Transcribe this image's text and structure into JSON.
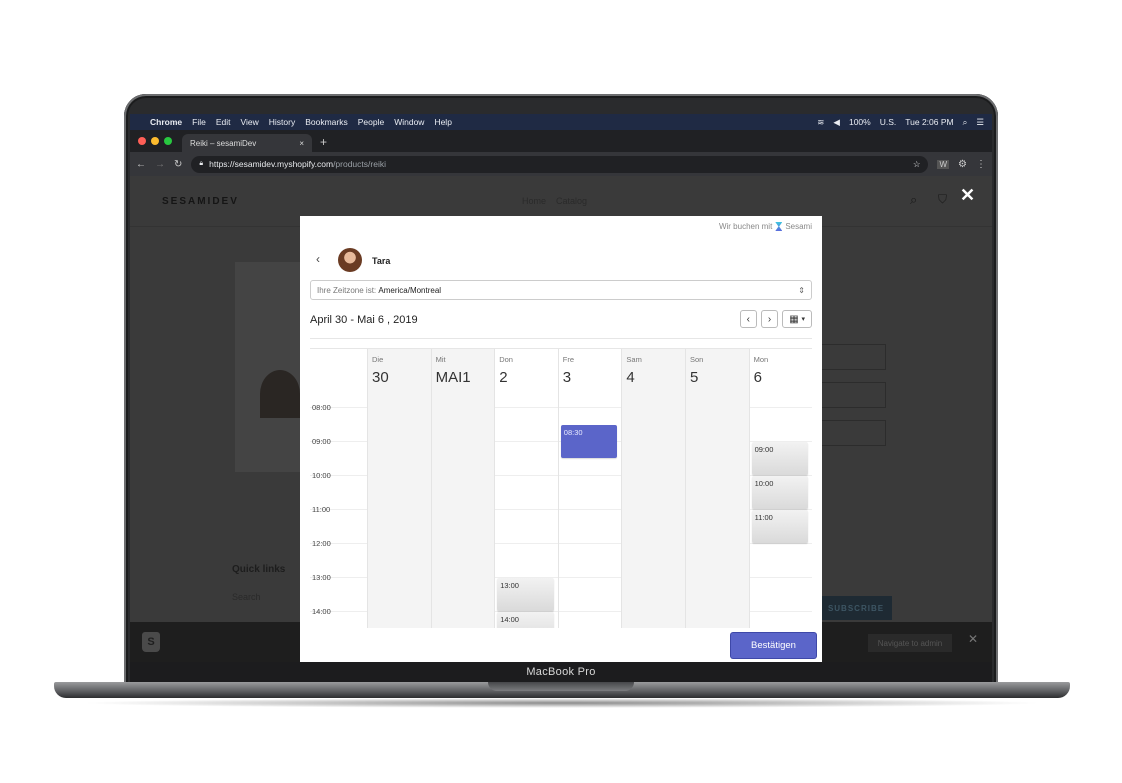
{
  "device": {
    "label": "MacBook Pro"
  },
  "menubar": {
    "items": [
      "Chrome",
      "File",
      "Edit",
      "View",
      "History",
      "Bookmarks",
      "People",
      "Window",
      "Help"
    ],
    "battery": "100%",
    "input": "U.S.",
    "clock": "Tue 2:06 PM"
  },
  "browser": {
    "tab_title": "Reiki – sesamiDev",
    "url_host": "https://sesamidev.myshopify.com",
    "url_path": "/products/reiki"
  },
  "shop": {
    "logo": "SESAMIDEV",
    "nav": [
      "Home",
      "Catalog"
    ],
    "quick_links": "Quick links",
    "search": "Search",
    "subscribe": "SUBSCRIBE",
    "navigate_admin": "Navigate to admin"
  },
  "widget": {
    "booked_with": "Wir buchen mit",
    "brand": "Sesami",
    "provider": "Tara",
    "tz_label": "Ihre Zeitzone ist:",
    "tz_value": "America/Montreal",
    "range": "April 30 - Mai  6 , 2019",
    "confirm": "Bestätigen",
    "days": [
      {
        "name": "Die",
        "num": "30",
        "past": true
      },
      {
        "name": "Mit",
        "num": "MAI1",
        "past": true
      },
      {
        "name": "Don",
        "num": "2",
        "past": false
      },
      {
        "name": "Fre",
        "num": "3",
        "past": false
      },
      {
        "name": "Sam",
        "num": "4",
        "past": true
      },
      {
        "name": "Son",
        "num": "5",
        "past": true
      },
      {
        "name": "Mon",
        "num": "6",
        "past": false
      }
    ],
    "times": [
      "08:00",
      "09:00",
      "10:00",
      "11:00",
      "12:00",
      "13:00",
      "14:00"
    ],
    "slots": [
      {
        "day": 3,
        "label": "08:30",
        "start": 8.5,
        "selected": true
      },
      {
        "day": 6,
        "label": "09:00",
        "start": 9,
        "selected": false
      },
      {
        "day": 6,
        "label": "10:00",
        "start": 10,
        "selected": false
      },
      {
        "day": 6,
        "label": "11:00",
        "start": 11,
        "selected": false
      },
      {
        "day": 2,
        "label": "13:00",
        "start": 13,
        "selected": false
      },
      {
        "day": 2,
        "label": "14:00",
        "start": 14,
        "selected": false
      }
    ]
  }
}
